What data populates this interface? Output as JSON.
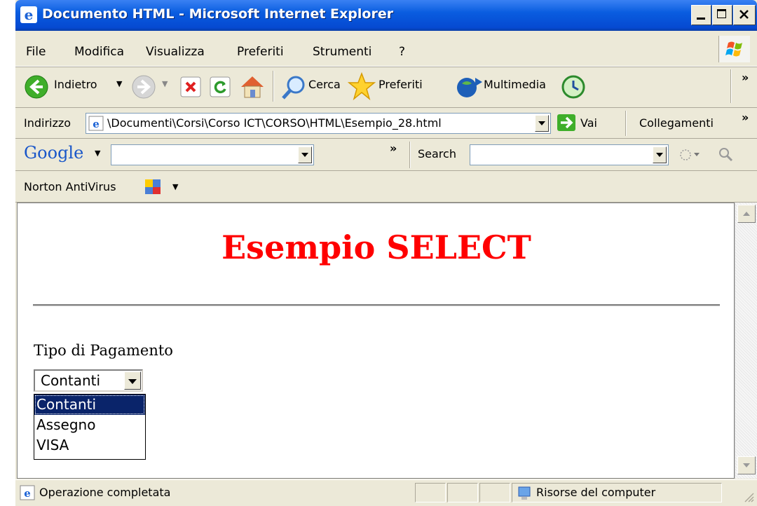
{
  "window": {
    "title": "Documento HTML - Microsoft Internet Explorer"
  },
  "menu": [
    "File",
    "Modifica",
    "Visualizza",
    "Preferiti",
    "Strumenti",
    "?"
  ],
  "toolbar": {
    "back": "Indietro",
    "search": "Cerca",
    "favorites": "Preferiti",
    "media": "Multimedia",
    "more": "»"
  },
  "address": {
    "label": "Indirizzo",
    "value": "\\Documenti\\Corsi\\Corso ICT\\CORSO\\HTML\\Esempio_28.html",
    "go": "Vai",
    "links": "Collegamenti",
    "more": "»"
  },
  "google_bar": {
    "logo": "Google",
    "more": "»",
    "search_label": "Search",
    "query": "",
    "search_query": ""
  },
  "norton": {
    "label": "Norton AntiVirus"
  },
  "page": {
    "heading": "Esempio SELECT",
    "field_label": "Tipo di Pagamento",
    "select_value": "Contanti",
    "options": [
      "Contanti",
      "Assegno",
      "VISA"
    ]
  },
  "status": {
    "text": "Operazione completata",
    "zone": "Risorse del computer"
  },
  "colors": {
    "titlebar": "#0a5de0",
    "heading": "#ff0000",
    "selection": "#0a246a"
  }
}
